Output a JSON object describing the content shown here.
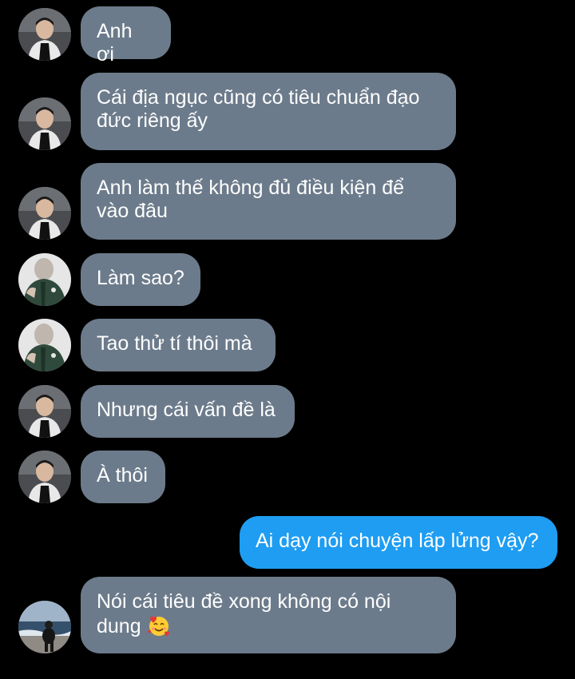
{
  "messages": [
    {
      "sender": "a",
      "text": "Anh ơi"
    },
    {
      "sender": "a",
      "text": "Cái địa ngục cũng có tiêu chuẩn đạo đức riêng ấy"
    },
    {
      "sender": "a",
      "text": "Anh làm thế không đủ điều kiện để vào đâu"
    },
    {
      "sender": "b",
      "text": "Làm sao?"
    },
    {
      "sender": "b",
      "text": "Tao thử tí thôi mà"
    },
    {
      "sender": "a",
      "text": "Nhưng cái vấn đề là"
    },
    {
      "sender": "a",
      "text": "À thôi"
    },
    {
      "sender": "me",
      "text": "Ai dạy nói chuyện lấp lửng vậy?"
    },
    {
      "sender": "c",
      "text": "Nói cái tiêu đề xong không có nội dung",
      "emoji": "smiling-face-with-hearts-icon"
    }
  ],
  "colors": {
    "background": "#000000",
    "incoming_bubble": "#6c7b8b",
    "outgoing_bubble": "#1e9df2",
    "text": "#ffffff"
  }
}
